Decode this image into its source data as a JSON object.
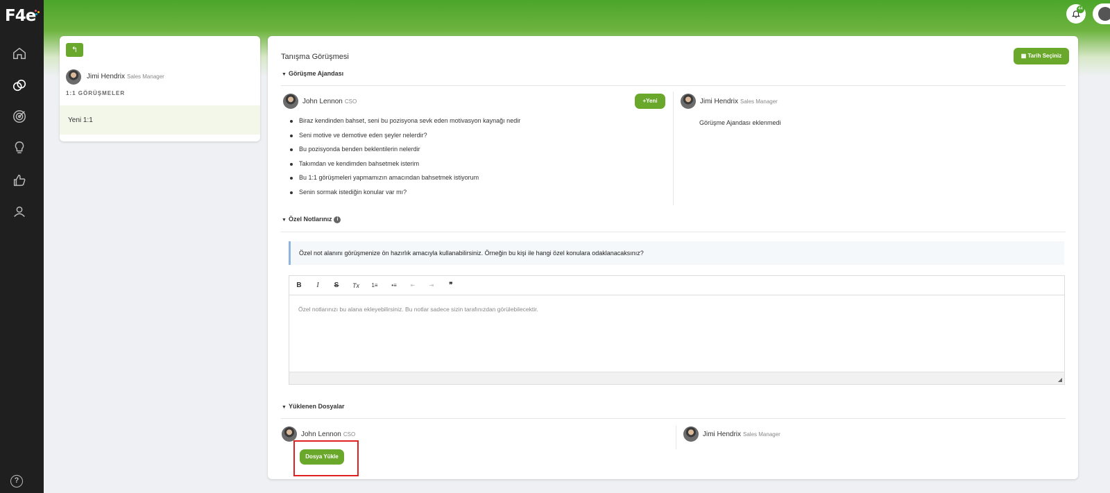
{
  "brand": {
    "logo_text": "F4e",
    "dot_colors": [
      "#e94e77",
      "#f5b700",
      "#00a3e0"
    ]
  },
  "colors": {
    "accent": "#6aa82b",
    "sidebar": "#1f1f1f",
    "highlight": "#e02020"
  },
  "sidebar": {
    "items": [
      {
        "icon": "home-icon"
      },
      {
        "icon": "meetings-icon"
      },
      {
        "icon": "target-icon"
      },
      {
        "icon": "lightbulb-icon"
      },
      {
        "icon": "thumbs-up-icon"
      },
      {
        "icon": "users-icon"
      }
    ],
    "help_label": "?"
  },
  "header": {
    "notification_count": "44"
  },
  "left_panel": {
    "back_icon": "↰",
    "user_name": "Jimi Hendrix",
    "user_role": "Sales Manager",
    "section_title": "1:1 GÖRÜŞMELER",
    "items": [
      "Yeni 1:1"
    ]
  },
  "main": {
    "title": "Tanışma Görüşmesi",
    "date_button": "Tarih Seçiniz",
    "agenda": {
      "title": "Görüşme Ajandası",
      "left_user": {
        "name": "John Lennon",
        "role": "CSO"
      },
      "new_button": "Yeni",
      "items": [
        "Biraz kendinden bahset, seni bu pozisyona sevk eden motivasyon kaynağı nedir",
        "Seni motive ve demotive eden şeyler nelerdir?",
        "Bu pozisyonda benden beklentilerin nelerdir",
        "Takımdan ve kendimden bahsetmek isterim",
        "Bu 1:1 görüşmeleri yapmamızın amacından bahsetmek istiyorum",
        "Senin sormak istediğin konular var mı?"
      ],
      "right_user": {
        "name": "Jimi Hendrix",
        "role": "Sales Manager"
      },
      "empty_text": "Görüşme Ajandası eklenmedi"
    },
    "notes": {
      "title": "Özel Notlarınız",
      "hint": "Özel not alanını görüşmenize ön hazırlık amacıyla kullanabilirsiniz. Örneğin bu kişi ile hangi özel konulara odaklanacaksınız?",
      "placeholder": "Özel notlarınızı bu alana ekleyebilirsiniz. Bu notlar sadece sizin tarafınızdan görülebilecektir.",
      "toolbar": {
        "bold": "B",
        "italic": "I",
        "strike": "S",
        "clear": "Tx",
        "ordered_list": "1≡",
        "bullet_list": "•≡",
        "outdent": "⇤",
        "indent": "⇥",
        "quote": "❞"
      }
    },
    "files": {
      "title": "Yüklenen Dosyalar",
      "left_user": {
        "name": "John Lennon",
        "role": "CSO"
      },
      "right_user": {
        "name": "Jimi Hendrix",
        "role": "Sales Manager"
      },
      "upload_button": "Dosya Yükle"
    }
  }
}
